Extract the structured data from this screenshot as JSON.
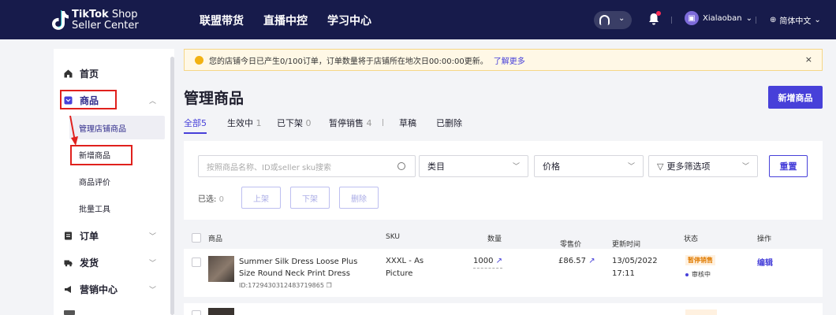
{
  "brand": {
    "name_bold": "TikTok",
    "name_rest": " Shop",
    "subtitle": "Seller Center"
  },
  "topnav": [
    "联盟带货",
    "直播中控",
    "学习中心"
  ],
  "header": {
    "username": "Xialaoban",
    "language": "简体中文"
  },
  "sidebar": {
    "items": [
      {
        "label": "首页",
        "icon": "home-icon"
      },
      {
        "label": "商品",
        "icon": "product-icon"
      },
      {
        "label": "订单",
        "icon": "order-icon"
      },
      {
        "label": "发货",
        "icon": "shipping-icon"
      },
      {
        "label": "营销中心",
        "icon": "marketing-icon"
      }
    ],
    "sub_items": [
      "管理店铺商品",
      "新增商品",
      "商品评价",
      "批量工具"
    ]
  },
  "notice": {
    "text": "您的店铺今日已产生0/100订单，订单数量将于店铺所在地次日00:00:00更新。",
    "link": "了解更多",
    "close": "×"
  },
  "page": {
    "title": "管理商品",
    "add_button": "新增商品"
  },
  "tabs": [
    {
      "label": "全部",
      "count": "5"
    },
    {
      "label": "生效中",
      "count": "1"
    },
    {
      "label": "已下架",
      "count": "0"
    },
    {
      "label": "暂停销售",
      "count": "4"
    },
    {
      "label": "草稿",
      "count": ""
    },
    {
      "label": "已删除",
      "count": ""
    }
  ],
  "filters": {
    "search_placeholder": "按照商品名称、ID或seller sku搜索",
    "category": "类目",
    "price": "价格",
    "more": "更多筛选项",
    "reset": "重置",
    "selected_label": "已选:",
    "selected_count": "0",
    "bulk_actions": [
      "上架",
      "下架",
      "删除"
    ]
  },
  "table": {
    "headers": [
      "商品",
      "SKU",
      "数量",
      "零售价",
      "更新时间",
      "状态",
      "操作"
    ],
    "rows": [
      {
        "name": "Summer Silk Dress Loose Plus Size Round Neck Print Dress Elegan...",
        "id": "ID:1729430312483719865",
        "sku": "XXXL - As Picture",
        "quantity": "1000",
        "price": "£86.57",
        "updated_date": "13/05/2022",
        "updated_time": "17:11",
        "status": "暂停销售",
        "review": "审核中",
        "action": "编辑"
      }
    ]
  }
}
